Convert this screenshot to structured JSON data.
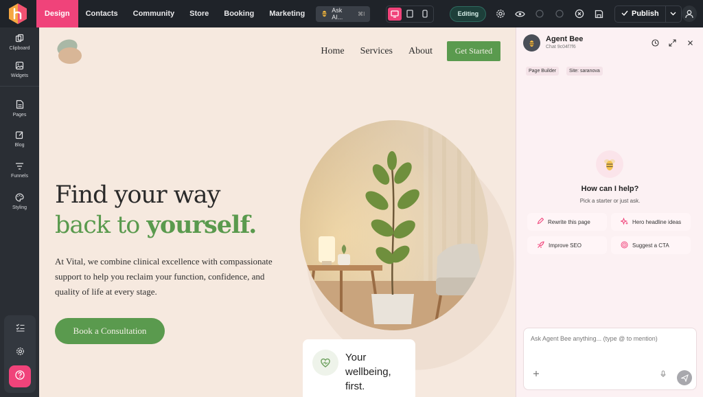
{
  "topbar": {
    "tabs": [
      {
        "label": "Design",
        "active": true
      },
      {
        "label": "Contacts"
      },
      {
        "label": "Community"
      },
      {
        "label": "Store"
      },
      {
        "label": "Booking"
      },
      {
        "label": "Marketing"
      }
    ],
    "ask_ai": {
      "label": "Ask AI...",
      "shortcut": "⌘I"
    },
    "devices": [
      "desktop-icon",
      "tablet-icon",
      "mobile-icon"
    ],
    "mode_badge": "Editing",
    "publish_label": "Publish",
    "accent": "#f0437a"
  },
  "sidebar": {
    "items": [
      {
        "label": "Clipboard",
        "icon": "clipboard-icon"
      },
      {
        "label": "Widgets",
        "icon": "widgets-icon"
      },
      {
        "label": "Pages",
        "icon": "pages-icon"
      },
      {
        "label": "Blog",
        "icon": "blog-icon"
      },
      {
        "label": "Funnels",
        "icon": "funnels-icon"
      },
      {
        "label": "Styling",
        "icon": "palette-icon"
      }
    ]
  },
  "site": {
    "nav": [
      "Home",
      "Services",
      "About"
    ],
    "cta_label": "Get Started",
    "headline_line1": "Find your way",
    "headline_line2a": "back to ",
    "headline_line2b": "yourself.",
    "lead": "At Vital, we combine clinical excellence with compassionate support to help you reclaim your function, confidence, and quality of life at every stage.",
    "button_label": "Book a Consultation",
    "card_text": "Your wellbeing, first.",
    "brand_green": "#5a9a4e",
    "background": "#f6e9df"
  },
  "agent": {
    "name": "Agent Bee",
    "chat_id": "Chat 9c04f7f6",
    "chips": [
      "Page Builder",
      "Site: saranova"
    ],
    "heading": "How can I help?",
    "subheading": "Pick a starter or just ask.",
    "starters": [
      {
        "label": "Rewrite this page",
        "icon": "pen-icon"
      },
      {
        "label": "Hero headline ideas",
        "icon": "sparkle-icon"
      },
      {
        "label": "Improve SEO",
        "icon": "rocket-icon"
      },
      {
        "label": "Suggest a CTA",
        "icon": "target-icon"
      }
    ],
    "input_placeholder": "Ask Agent Bee anything... (type @ to mention)"
  }
}
